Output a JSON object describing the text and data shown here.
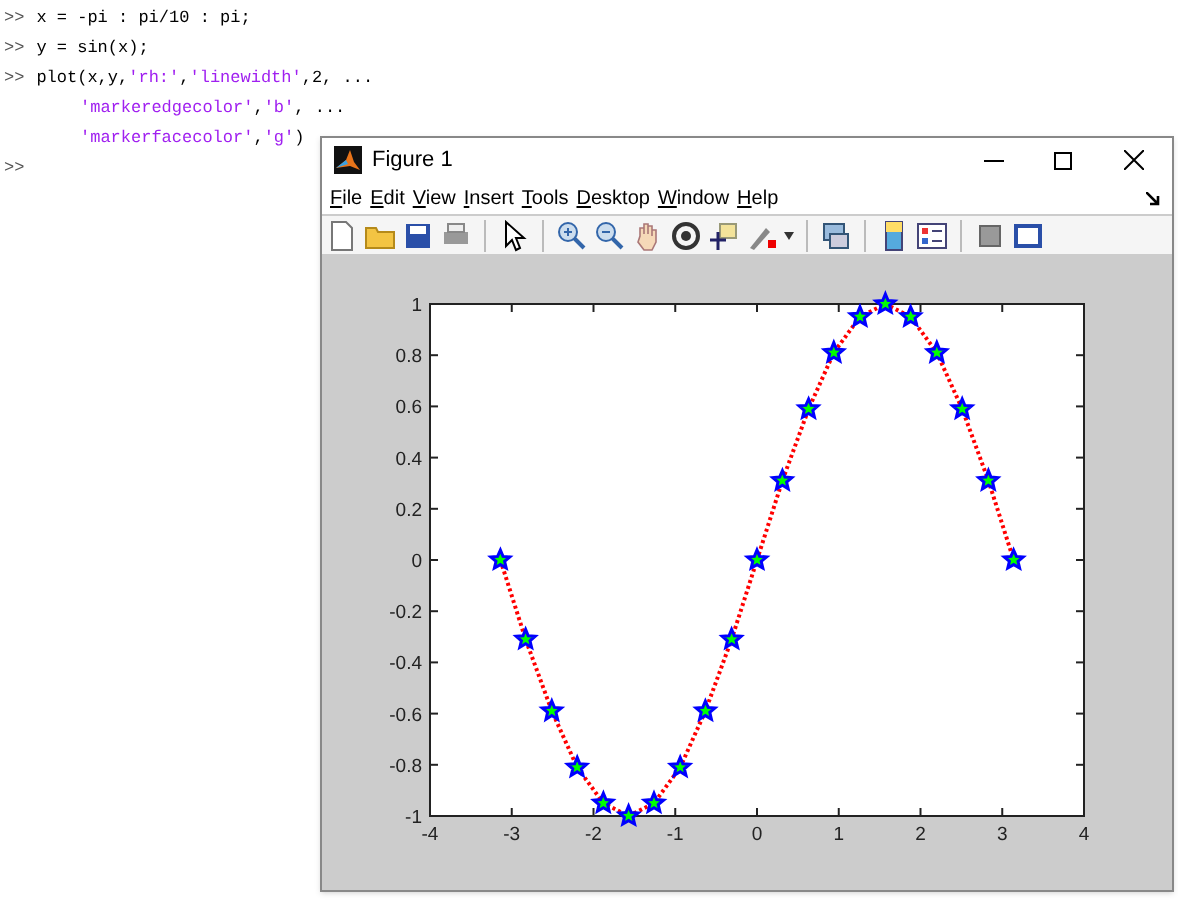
{
  "command_window": {
    "lines": [
      {
        "prompt": ">>",
        "parts": [
          {
            "text": "x = -pi : pi/10 : pi;",
            "kind": "code"
          }
        ]
      },
      {
        "prompt": ">>",
        "parts": [
          {
            "text": "y = sin(x);",
            "kind": "code"
          }
        ]
      },
      {
        "prompt": ">>",
        "parts": [
          {
            "text": "plot(x,y,",
            "kind": "code"
          },
          {
            "text": "'rh:'",
            "kind": "string"
          },
          {
            "text": ",",
            "kind": "code"
          },
          {
            "text": "'linewidth'",
            "kind": "string"
          },
          {
            "text": ",2, ...",
            "kind": "code"
          }
        ]
      },
      {
        "parts": [
          {
            "text": "'markeredgecolor'",
            "kind": "string"
          },
          {
            "text": ",",
            "kind": "code"
          },
          {
            "text": "'b'",
            "kind": "string"
          },
          {
            "text": ", ...",
            "kind": "code"
          }
        ]
      },
      {
        "parts": [
          {
            "text": "'markerfacecolor'",
            "kind": "string"
          },
          {
            "text": ",",
            "kind": "code"
          },
          {
            "text": "'g'",
            "kind": "string"
          },
          {
            "text": ")",
            "kind": "code"
          }
        ]
      },
      {
        "prompt": ">>"
      }
    ]
  },
  "figure": {
    "title": "Figure 1",
    "menu": [
      "File",
      "Edit",
      "View",
      "Insert",
      "Tools",
      "Desktop",
      "Window",
      "Help"
    ],
    "chart_data": {
      "type": "line",
      "xlim": [
        -4,
        4
      ],
      "ylim": [
        -1,
        1
      ],
      "xticks": [
        -4,
        -3,
        -2,
        -1,
        0,
        1,
        2,
        3,
        4
      ],
      "yticks": [
        {
          "value": -1,
          "label": "-1"
        },
        {
          "value": -0.8,
          "label": "-0.8"
        },
        {
          "value": -0.6,
          "label": "-0.6"
        },
        {
          "value": -0.4,
          "label": "-0.4"
        },
        {
          "value": -0.2,
          "label": "-0.2"
        },
        {
          "value": 0,
          "label": "0"
        },
        {
          "value": 0.2,
          "label": "0.2"
        },
        {
          "value": 0.4,
          "label": "0.4"
        },
        {
          "value": 0.6,
          "label": "0.6"
        },
        {
          "value": 0.8,
          "label": "0.8"
        },
        {
          "value": 1,
          "label": "1"
        }
      ],
      "x": [
        -3.14,
        -2.83,
        -2.51,
        -2.2,
        -1.88,
        -1.57,
        -1.26,
        -0.94,
        -0.63,
        -0.31,
        0,
        0.31,
        0.63,
        0.94,
        1.26,
        1.57,
        1.88,
        2.2,
        2.51,
        2.83,
        3.14
      ],
      "series": [
        {
          "color": "#ff0000",
          "line_style": "dotted",
          "marker": "star",
          "values": [
            0,
            -0.31,
            -0.59,
            -0.81,
            -0.95,
            -1,
            -0.95,
            -0.81,
            -0.59,
            -0.31,
            0,
            0.31,
            0.59,
            0.81,
            0.95,
            1,
            0.95,
            0.81,
            0.59,
            0.31,
            0
          ]
        }
      ]
    }
  }
}
